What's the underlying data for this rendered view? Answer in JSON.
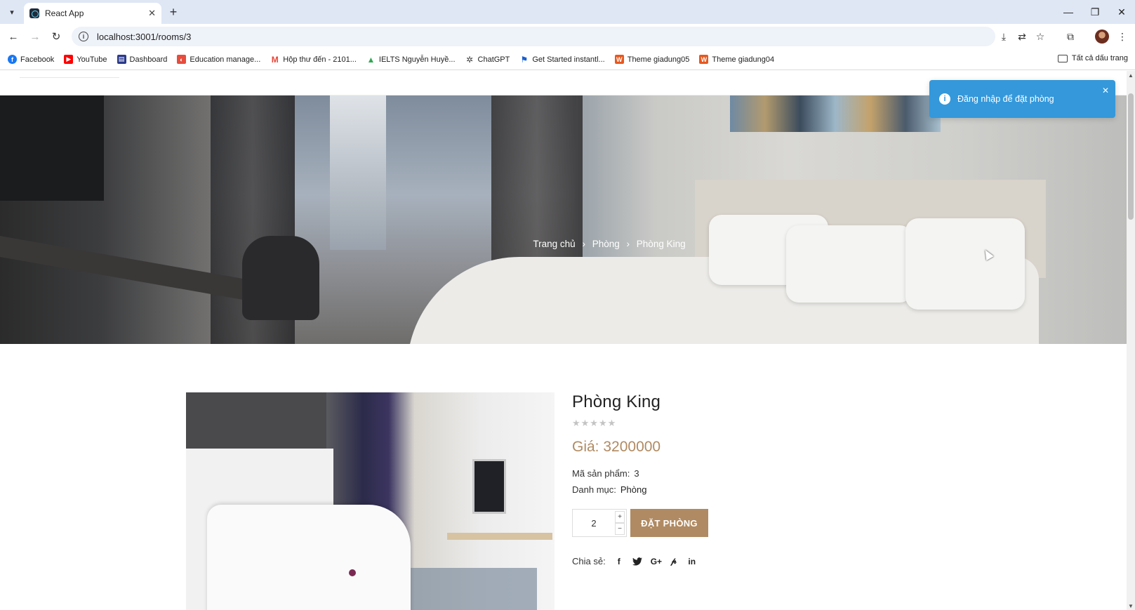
{
  "browser": {
    "tab_title": "React App",
    "url": "localhost:3001/rooms/3",
    "bookmarks": [
      {
        "label": "Facebook",
        "icon": "facebook-icon",
        "color": "#1877f2"
      },
      {
        "label": "YouTube",
        "icon": "youtube-icon",
        "color": "#ff0000"
      },
      {
        "label": "Dashboard",
        "icon": "dashboard-icon",
        "color": "#2b3a8c"
      },
      {
        "label": "Education manage...",
        "icon": "education-icon",
        "color": "#e74c3c"
      },
      {
        "label": "Hộp thư đến - 2101...",
        "icon": "gmail-icon",
        "color": "#ea4335"
      },
      {
        "label": "IELTS Nguyễn Huyề...",
        "icon": "drive-icon",
        "color": "#34a853"
      },
      {
        "label": "ChatGPT",
        "icon": "chatgpt-icon",
        "color": "#444444"
      },
      {
        "label": "Get Started instantl...",
        "icon": "flag-icon",
        "color": "#1a5fd0"
      },
      {
        "label": "Theme giadung05",
        "icon": "theme-icon",
        "color": "#e8581e"
      },
      {
        "label": "Theme giadung04",
        "icon": "theme-icon",
        "color": "#e8581e"
      }
    ],
    "all_bookmarks_label": "Tất cả dấu trang"
  },
  "hero": {
    "breadcrumb": [
      "Trang chủ",
      "Phòng",
      "Phòng King"
    ]
  },
  "toast": {
    "message": "Đăng nhập để đặt phòng"
  },
  "product": {
    "title": "Phòng King",
    "stars": "★★★★★",
    "rating": 0,
    "price_label": "Giá: 3200000",
    "sku_label": "Mã sản phẩm:",
    "sku_value": "3",
    "category_label": "Danh mục:",
    "category_value": "Phòng",
    "quantity": "2",
    "book_button": "ĐẶT PHÒNG",
    "share_label": "Chia sẻ:",
    "share_icons": [
      "facebook-icon",
      "twitter-icon",
      "google-plus-icon",
      "pinterest-icon",
      "linkedin-icon"
    ]
  },
  "colors": {
    "accent": "#b08a62",
    "toast": "#3498db"
  }
}
